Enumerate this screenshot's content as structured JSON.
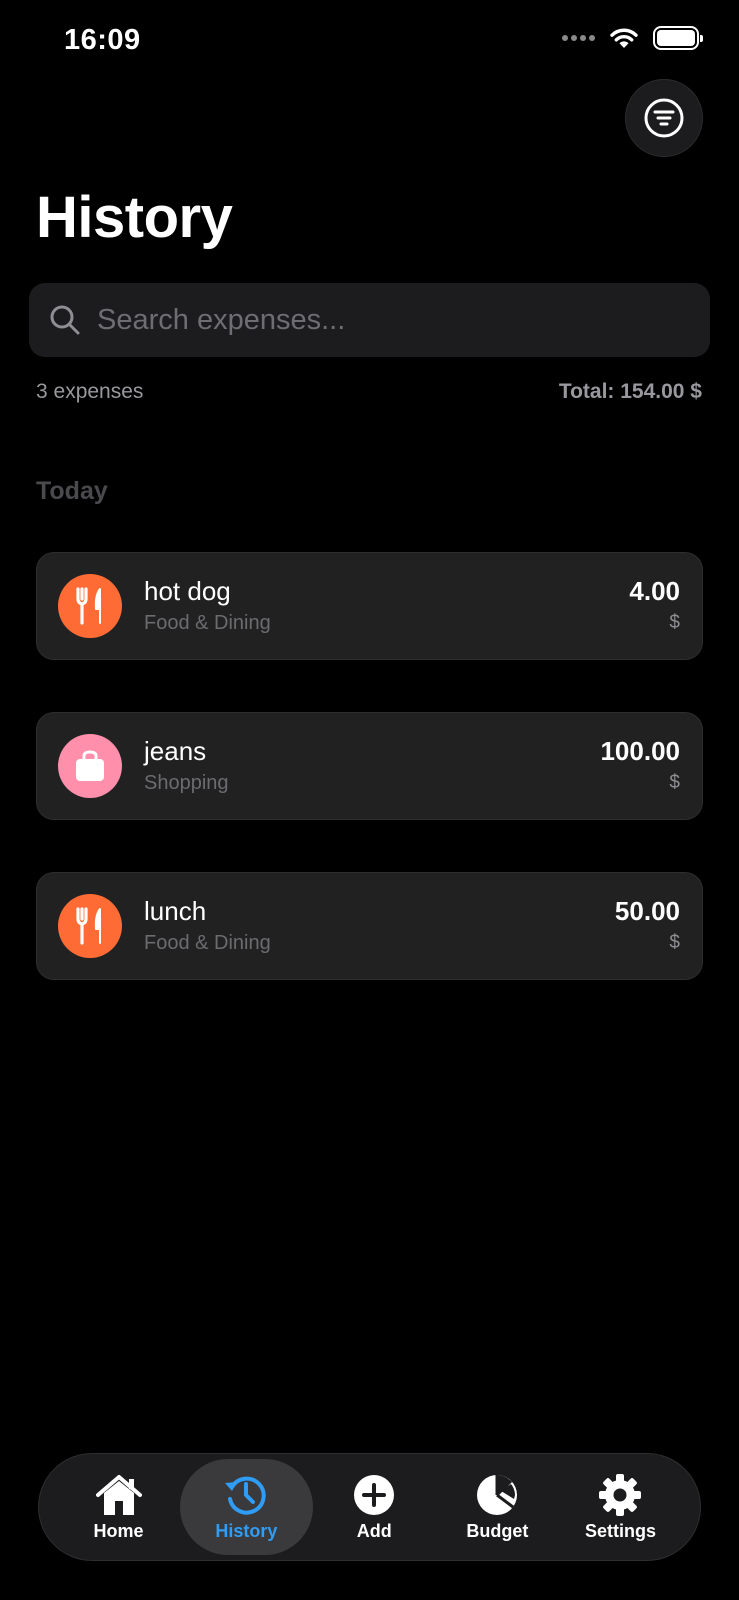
{
  "status_bar": {
    "time": "16:09"
  },
  "header": {
    "title": "History"
  },
  "search": {
    "placeholder": "Search expenses...",
    "value": ""
  },
  "summary": {
    "count": "3 expenses",
    "total": "Total: 154.00 $"
  },
  "sections": [
    {
      "label": "Today",
      "items": [
        {
          "name": "hot dog",
          "category": "Food & Dining",
          "amount": "4.00",
          "currency": "$",
          "icon": "fork-knife-icon",
          "color": "#ff6b35"
        },
        {
          "name": "jeans",
          "category": "Shopping",
          "amount": "100.00",
          "currency": "$",
          "icon": "shopping-bag-icon",
          "color": "#ff8fab"
        },
        {
          "name": "lunch",
          "category": "Food & Dining",
          "amount": "50.00",
          "currency": "$",
          "icon": "fork-knife-icon",
          "color": "#ff6b35"
        }
      ]
    }
  ],
  "tabbar": {
    "home": "Home",
    "history": "History",
    "add": "Add",
    "budget": "Budget",
    "settings": "Settings",
    "active": "history",
    "active_color": "#2f9cf5"
  }
}
